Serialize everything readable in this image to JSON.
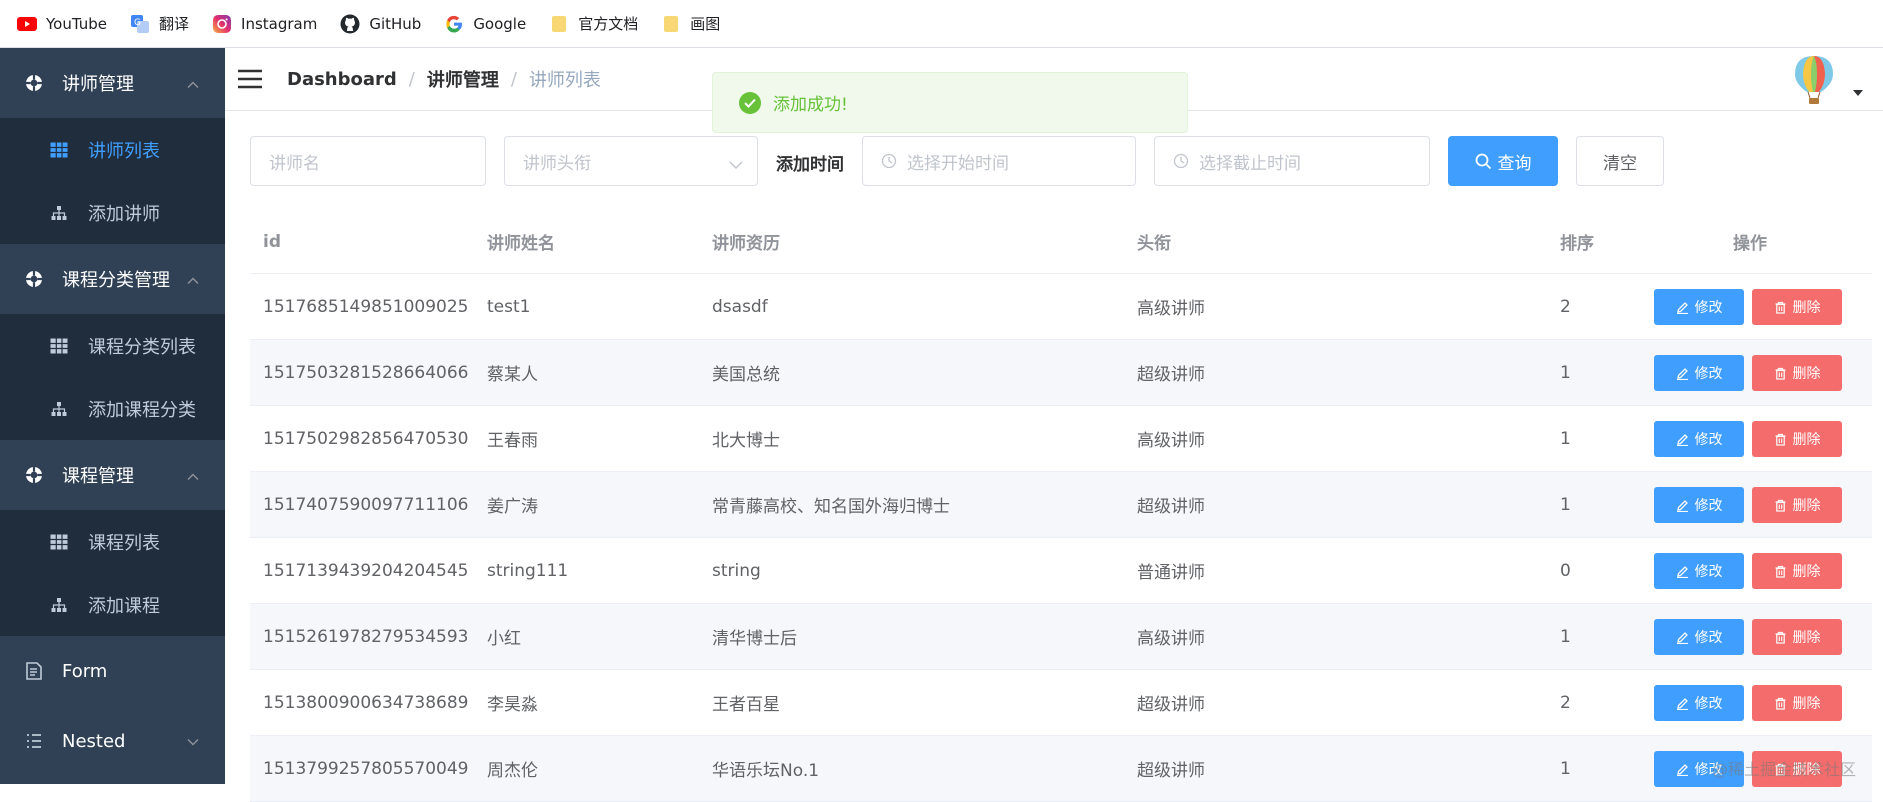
{
  "bookmarks": [
    {
      "label": "YouTube",
      "icon": "youtube-icon"
    },
    {
      "label": "翻译",
      "icon": "translate-icon"
    },
    {
      "label": "Instagram",
      "icon": "instagram-icon"
    },
    {
      "label": "GitHub",
      "icon": "github-icon"
    },
    {
      "label": "Google",
      "icon": "google-icon"
    },
    {
      "label": "官方文档",
      "icon": "folder-icon"
    },
    {
      "label": "画图",
      "icon": "folder-icon"
    }
  ],
  "sidebar": {
    "groups": [
      {
        "title": "讲师管理",
        "items": [
          "讲师列表",
          "添加讲师"
        ]
      },
      {
        "title": "课程分类管理",
        "items": [
          "课程分类列表",
          "添加课程分类"
        ]
      },
      {
        "title": "课程管理",
        "items": [
          "课程列表",
          "添加课程"
        ]
      }
    ],
    "form": "Form",
    "nested": "Nested",
    "active_item": "讲师列表"
  },
  "navbar": {
    "breadcrumb": [
      "Dashboard",
      "讲师管理",
      "讲师列表"
    ]
  },
  "toast": {
    "message": "添加成功!"
  },
  "filters": {
    "name_placeholder": "讲师名",
    "level_placeholder": "讲师头衔",
    "time_label": "添加时间",
    "start_placeholder": "选择开始时间",
    "end_placeholder": "选择截止时间",
    "search_label": "查询",
    "clear_label": "清空"
  },
  "table": {
    "headers": {
      "id": "id",
      "name": "讲师姓名",
      "intro": "讲师资历",
      "level": "头衔",
      "sort": "排序",
      "ops": "操作"
    },
    "edit_label": "修改",
    "delete_label": "删除",
    "rows": [
      {
        "id": "1517685149851009025",
        "name": "test1",
        "intro": "dsasdf",
        "level": "高级讲师",
        "sort": "2"
      },
      {
        "id": "1517503281528664066",
        "name": "蔡某人",
        "intro": "美国总统",
        "level": "超级讲师",
        "sort": "1"
      },
      {
        "id": "1517502982856470530",
        "name": "王春雨",
        "intro": "北大博士",
        "level": "高级讲师",
        "sort": "1"
      },
      {
        "id": "1517407590097711106",
        "name": "姜广涛",
        "intro": "常青藤高校、知名国外海归博士",
        "level": "超级讲师",
        "sort": "1"
      },
      {
        "id": "1517139439204204545",
        "name": "string111",
        "intro": "string",
        "level": "普通讲师",
        "sort": "0"
      },
      {
        "id": "1515261978279534593",
        "name": "小红",
        "intro": "清华博士后",
        "level": "高级讲师",
        "sort": "1"
      },
      {
        "id": "1513800900634738689",
        "name": "李昊淼",
        "intro": "王者百星",
        "level": "超级讲师",
        "sort": "2"
      },
      {
        "id": "1513799257805570049",
        "name": "周杰伦",
        "intro": "华语乐坛No.1",
        "level": "超级讲师",
        "sort": "1"
      }
    ]
  },
  "watermark": "@稀土掘金技术社区",
  "colors": {
    "sidebar": "#304156",
    "submenu": "#1f2d3d",
    "primary": "#409eff",
    "danger": "#f56c6c",
    "success": "#67c23a"
  }
}
